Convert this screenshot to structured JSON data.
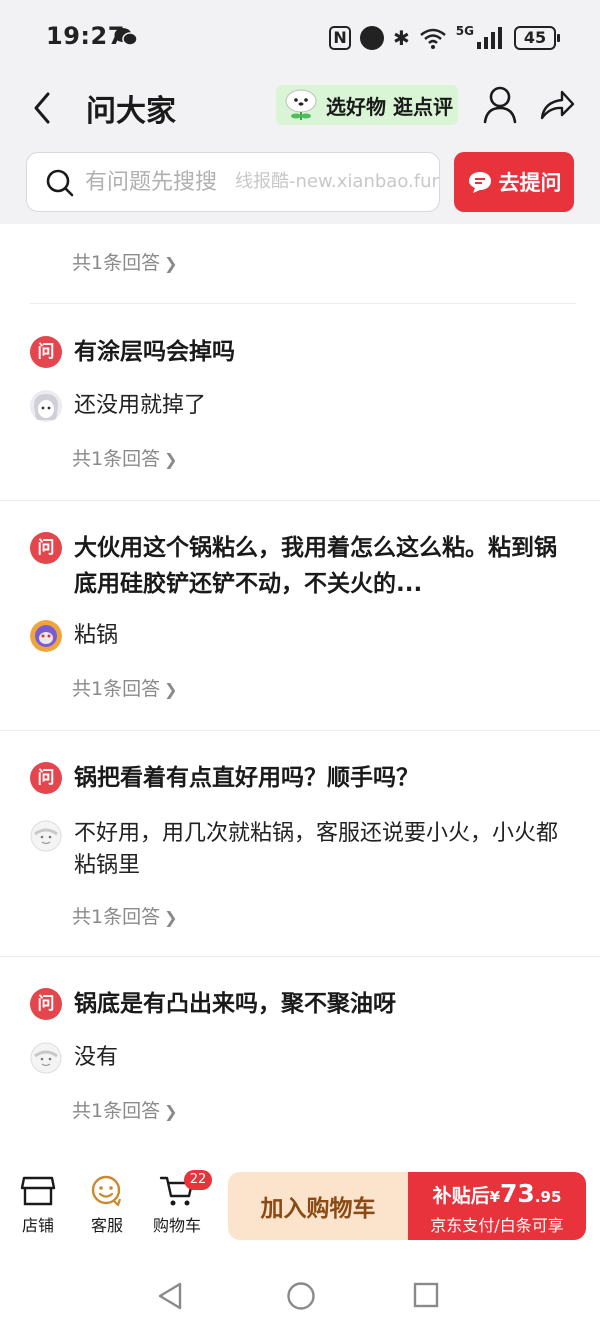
{
  "status_bar": {
    "time": "19:27",
    "nfc_label": "N",
    "network_label": "5G",
    "battery": "45"
  },
  "header": {
    "title": "问大家",
    "promo": "选好物 逛点评"
  },
  "search": {
    "placeholder": "有问题先搜搜",
    "watermark": "线报酷-new.xianbao.fun",
    "ask_button": "去提问"
  },
  "question_badge": "问",
  "questions": [
    {
      "count": "共1条回答"
    },
    {
      "question": "有涂层吗会掉吗",
      "answer": "还没用就掉了",
      "count": "共1条回答"
    },
    {
      "question": "大伙用这个锅粘么，我用着怎么这么粘。粘到锅底用硅胶铲还铲不动，不关火的...",
      "answer": "粘锅",
      "count": "共1条回答"
    },
    {
      "question": "锅把看着有点直好用吗？顺手吗？",
      "answer": "不好用，用几次就粘锅，客服还说要小火，小火都粘锅里",
      "count": "共1条回答"
    },
    {
      "question": "锅底是有凸出来吗，聚不聚油呀",
      "answer": "没有",
      "count": "共1条回答"
    }
  ],
  "bottom_bar": {
    "store": "店铺",
    "service": "客服",
    "cart": "购物车",
    "cart_count": "22",
    "add_to_cart": "加入购物车",
    "buy_prefix": "补贴后",
    "buy_currency": "¥",
    "buy_price_int": "73",
    "buy_price_dec": ".95",
    "buy_sub": "京东支付/白条可享"
  },
  "colors": {
    "accent": "#e8323c",
    "promo_bg": "#d9f5d6",
    "add_cart_bg": "#fbe3cc"
  }
}
